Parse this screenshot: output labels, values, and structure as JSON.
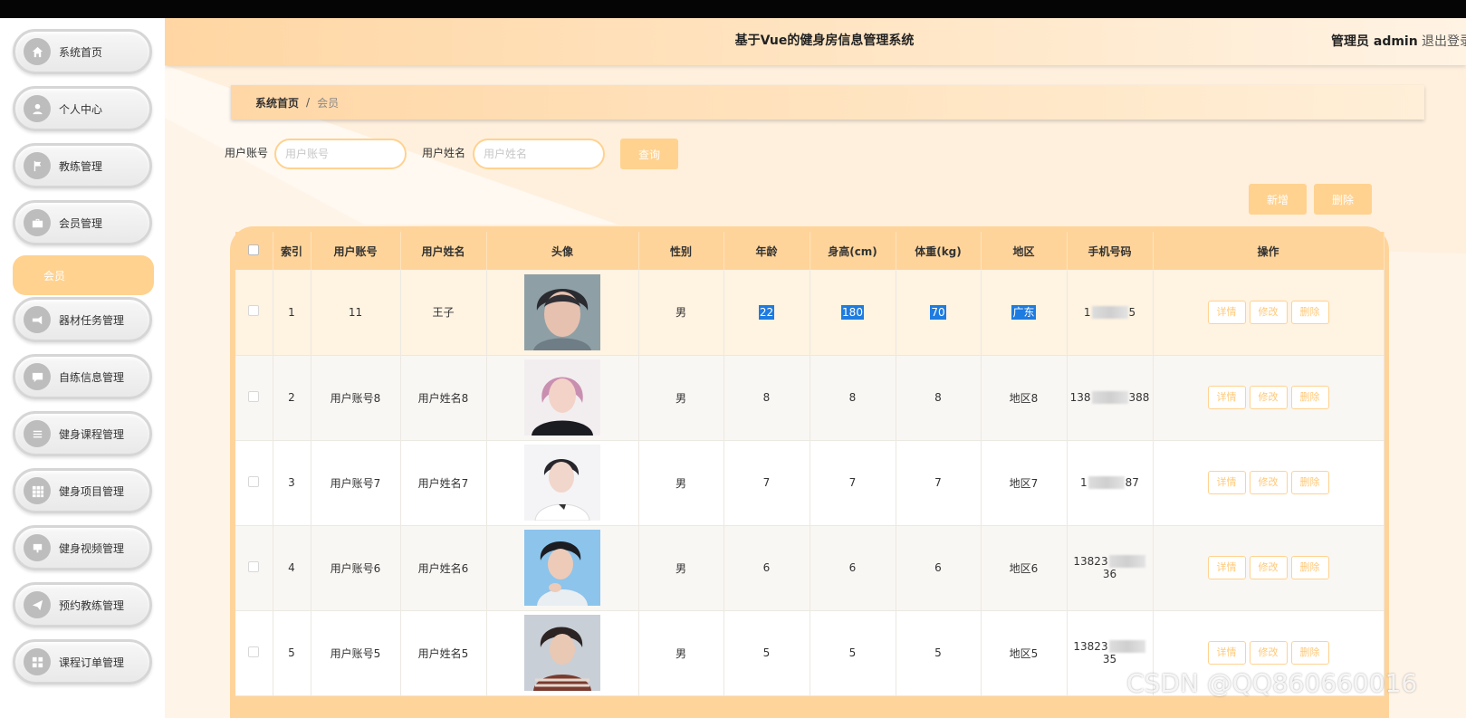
{
  "header": {
    "title": "基于Vue的健身房信息管理系统",
    "user": "管理员 admin",
    "logout": "退出登录"
  },
  "sidebar": {
    "items": [
      {
        "label": "系统首页",
        "icon": "home-icon"
      },
      {
        "label": "个人中心",
        "icon": "user-icon"
      },
      {
        "label": "教练管理",
        "icon": "flag-icon"
      },
      {
        "label": "会员管理",
        "icon": "briefcase-icon"
      },
      {
        "label": "器材任务管理",
        "icon": "tag-icon"
      },
      {
        "label": "自练信息管理",
        "icon": "chat-icon"
      },
      {
        "label": "健身课程管理",
        "icon": "list-icon"
      },
      {
        "label": "健身项目管理",
        "icon": "grid-icon"
      },
      {
        "label": "健身视频管理",
        "icon": "video-icon"
      },
      {
        "label": "预约教练管理",
        "icon": "send-icon"
      },
      {
        "label": "课程订单管理",
        "icon": "apps-icon"
      }
    ],
    "active_sub": "会员"
  },
  "breadcrumb": {
    "home": "系统首页",
    "separator": "/",
    "current": "会员"
  },
  "search": {
    "account_label": "用户账号",
    "account_placeholder": "用户账号",
    "name_label": "用户姓名",
    "name_placeholder": "用户姓名",
    "query_button": "查询"
  },
  "actions": {
    "add": "新增",
    "delete": "删除"
  },
  "table": {
    "columns": [
      "",
      "索引",
      "用户账号",
      "用户姓名",
      "头像",
      "性别",
      "年龄",
      "身高(cm)",
      "体重(kg)",
      "地区",
      "手机号码",
      "操作"
    ],
    "rows": [
      {
        "index": "1",
        "account": "11",
        "name": "王子",
        "gender": "男",
        "age": "22",
        "height": "180",
        "weight": "70",
        "region": "广东",
        "phone_start": "1",
        "phone_end": "5"
      },
      {
        "index": "2",
        "account": "用户账号8",
        "name": "用户姓名8",
        "gender": "男",
        "age": "8",
        "height": "8",
        "weight": "8",
        "region": "地区8",
        "phone_start": "138",
        "phone_end": "388"
      },
      {
        "index": "3",
        "account": "用户账号7",
        "name": "用户姓名7",
        "gender": "男",
        "age": "7",
        "height": "7",
        "weight": "7",
        "region": "地区7",
        "phone_start": "1",
        "phone_end": "87"
      },
      {
        "index": "4",
        "account": "用户账号6",
        "name": "用户姓名6",
        "gender": "男",
        "age": "6",
        "height": "6",
        "weight": "6",
        "region": "地区6",
        "phone_start": "13823",
        "phone_end": "36"
      },
      {
        "index": "5",
        "account": "用户账号5",
        "name": "用户姓名5",
        "gender": "男",
        "age": "5",
        "height": "5",
        "weight": "5",
        "region": "地区5",
        "phone_start": "13823",
        "phone_end": "35"
      }
    ],
    "row_ops": {
      "detail": "详情",
      "edit": "修改",
      "delete": "删除"
    }
  },
  "watermark": "CSDN @QQ860660016",
  "colors": {
    "accent": "#ffd28f",
    "header": "#ffd6a3",
    "selection": "#1e7be0"
  }
}
